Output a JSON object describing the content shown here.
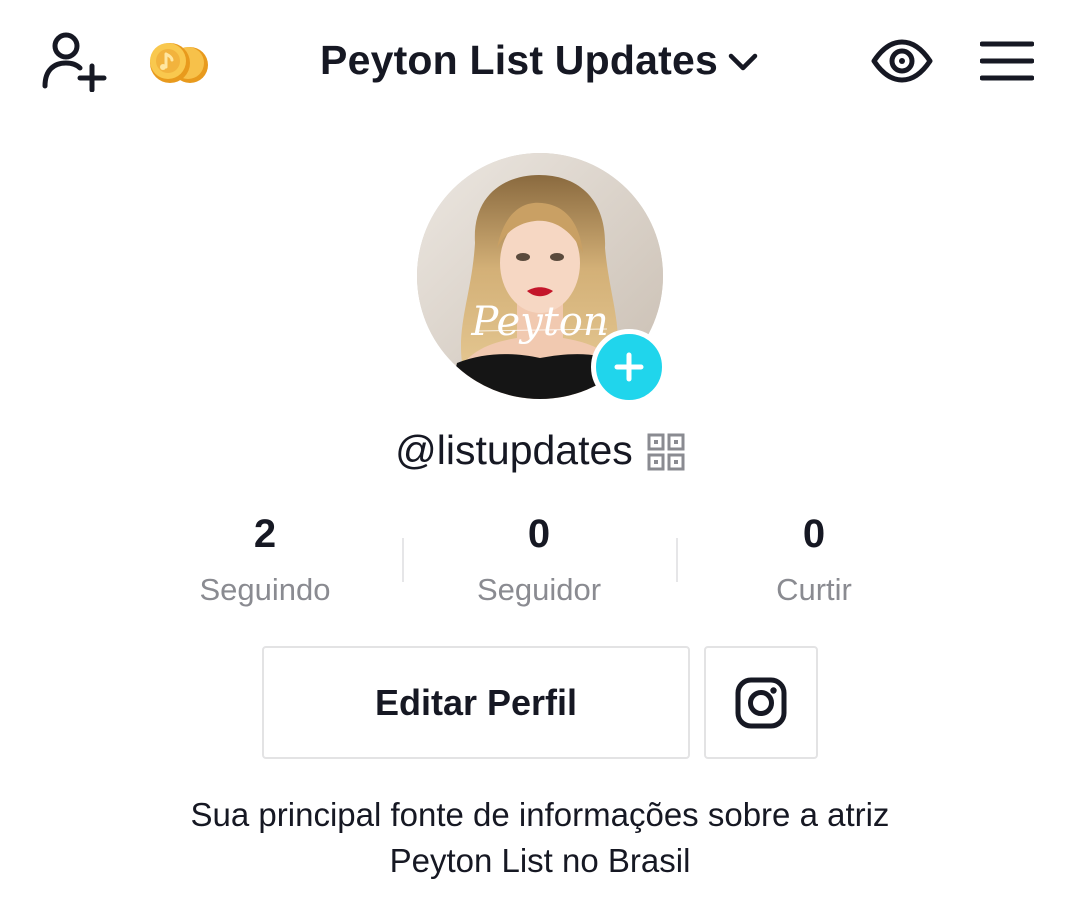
{
  "header": {
    "title": "Peyton List Updates",
    "icons": {
      "add_friend": "add-user-icon",
      "coins": "coins-icon",
      "dropdown": "chevron-down-icon",
      "views": "eye-icon",
      "menu": "hamburger-menu-icon"
    }
  },
  "profile": {
    "avatar_signature": "Peyton",
    "add_icon": "plus-icon",
    "username": "@listupdates",
    "qr_icon": "qr-code-icon"
  },
  "stats": [
    {
      "value": "2",
      "label": "Seguindo"
    },
    {
      "value": "0",
      "label": "Seguidor"
    },
    {
      "value": "0",
      "label": "Curtir"
    }
  ],
  "actions": {
    "edit_profile_label": "Editar Perfil",
    "instagram_icon": "instagram-icon"
  },
  "bio": {
    "line1": "Sua principal fonte de informações sobre a atriz",
    "line2": "Peyton List no Brasil"
  },
  "colors": {
    "text_primary": "#161823",
    "text_secondary": "#8a8b91",
    "accent_cyan": "#20d5ec",
    "border": "#e3e3e4",
    "coin_gold": "#f2b33d"
  }
}
